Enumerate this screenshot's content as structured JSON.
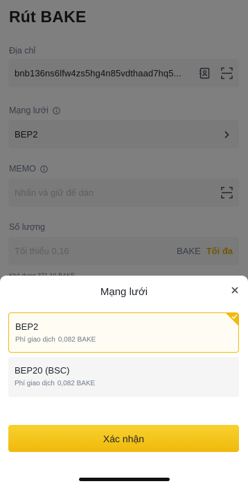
{
  "page": {
    "title": "Rút BAKE",
    "address": {
      "label": "Địa chỉ",
      "value": "bnb136ns6lfw4zs5hg4n85vdthaad7hq5...",
      "icons": [
        "address-book-icon",
        "scan-icon"
      ]
    },
    "network": {
      "label": "Mạng lưới",
      "value": "BEP2",
      "icon": "info-icon"
    },
    "memo": {
      "label": "MEMO",
      "placeholder": "Nhấn và giữ để dán",
      "icon": "info-icon"
    },
    "amount": {
      "label": "Số lượng",
      "placeholder": "Tối thiểu 0,16",
      "unit": "BAKE",
      "max_label": "Tối đa"
    },
    "peek_text": "Khả dụng 371,10 BAKE"
  },
  "sheet": {
    "title": "Mạng lưới",
    "options": [
      {
        "name": "BEP2",
        "fee_label": "Phí giao dịch",
        "fee_value": "0,082 BAKE",
        "selected": true
      },
      {
        "name": "BEP20 (BSC)",
        "fee_label": "Phí giao dịch",
        "fee_value": "0,082 BAKE",
        "selected": false
      }
    ],
    "confirm_label": "Xác nhận"
  },
  "colors": {
    "accent": "#f0b90b",
    "accent_light": "#f8d12f",
    "text": "#1e2329",
    "muted": "#707a8a",
    "field_bg": "#f5f5f5",
    "max_link": "#e0ac08"
  }
}
